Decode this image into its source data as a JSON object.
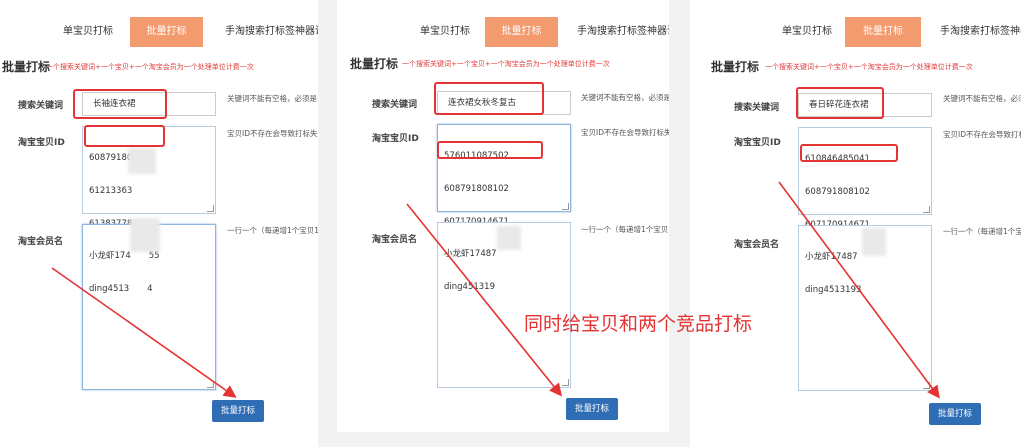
{
  "tabs": {
    "single": "单宝贝打标",
    "batch": "批量打标",
    "guide_p1": "手淘搜索打标签神器说明",
    "guide_p3": "手淘搜索打标签神器"
  },
  "header": {
    "title": "批量打标",
    "desc": "一个搜索关键词+一个宝贝+一个淘宝会员为一个处理单位计费一次"
  },
  "labels": {
    "keyword": "搜索关键词",
    "item_id": "淘宝宝贝ID",
    "member": "淘宝会员名"
  },
  "hints": {
    "keyword_p1": "关键词不能有空格，必须是",
    "keyword_p2": "关键词不能有空格，必须是",
    "keyword_p3": "关键词不能有空格，必须",
    "item_id_p1": "宝贝ID不存在会导致打标失",
    "item_id_p2": "宝贝ID不存在会导致打标失",
    "item_id_p3": "宝贝ID不存在会导致打标",
    "member_p1": "一行一个（每递增1个宝贝1",
    "member_p2": "一行一个（每递增1个宝贝",
    "member_p3": "一行一个（每递增1个宝"
  },
  "panels": [
    {
      "keyword": "长袖连衣裙",
      "item_ids": [
        "60879180",
        "61213363",
        "61383778"
      ],
      "members": [
        "小龙虾174",
        "ding4513"
      ],
      "member_tails": [
        "55",
        "4"
      ]
    },
    {
      "keyword": "连衣裙女秋冬复古",
      "item_ids": [
        "576011087502",
        "608791808102",
        "607170914671"
      ],
      "members": [
        "小龙虾17487",
        "ding451319"
      ]
    },
    {
      "keyword": "春日碎花连衣裙",
      "item_ids": [
        "610846485041",
        "608791808102",
        "607170914671"
      ],
      "members": [
        "小龙虾17487",
        "ding4513193"
      ]
    }
  ],
  "button": "批量打标",
  "caption": "同时给宝贝和两个竞品打标",
  "colors": {
    "accent_tab": "#f39a6e",
    "header_desc": "#e03a3a",
    "button": "#2f6db5",
    "annotation": "#e53333"
  }
}
